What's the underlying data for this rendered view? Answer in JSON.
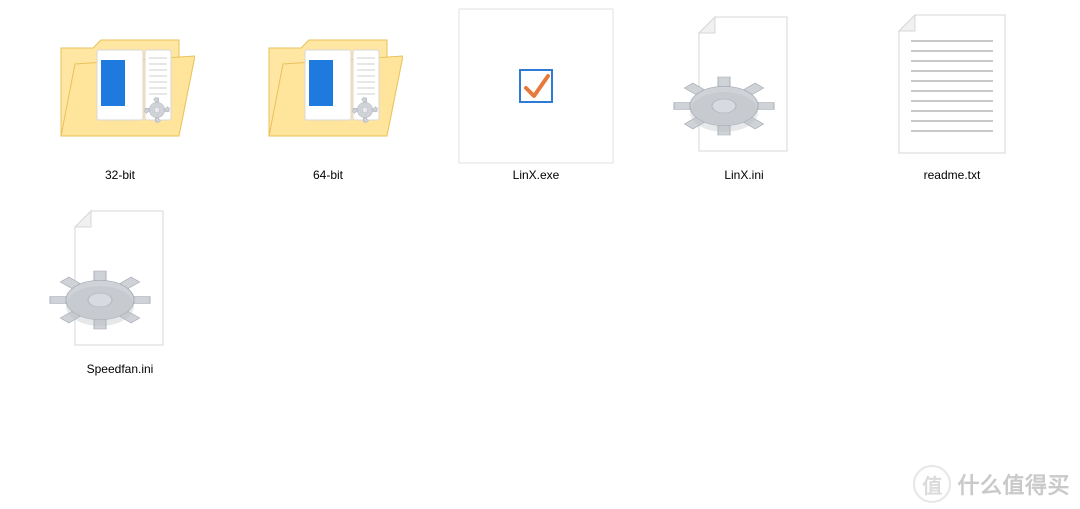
{
  "items": [
    {
      "name": "32-bit",
      "type": "folder"
    },
    {
      "name": "64-bit",
      "type": "folder"
    },
    {
      "name": "LinX.exe",
      "type": "exe"
    },
    {
      "name": "LinX.ini",
      "type": "ini"
    },
    {
      "name": "readme.txt",
      "type": "txt"
    },
    {
      "name": "Speedfan.ini",
      "type": "ini"
    }
  ],
  "watermark": {
    "badge": "值",
    "text": "什么值得买"
  }
}
